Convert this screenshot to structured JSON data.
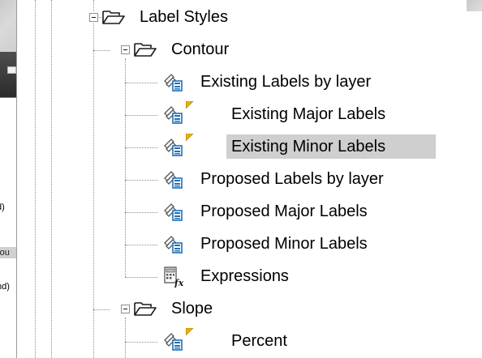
{
  "left_panel": {
    "texts": [
      "d)",
      "rou",
      ")",
      "nd)"
    ]
  },
  "tree": {
    "label_styles": "Label Styles",
    "contour": "Contour",
    "contour_items": [
      "Existing Labels by layer",
      "Existing Major Labels",
      "Existing Minor Labels",
      "Proposed Labels by layer",
      "Proposed Major Labels",
      "Proposed Minor Labels"
    ],
    "expressions": "Expressions",
    "slope": "Slope",
    "slope_items": [
      "Percent"
    ],
    "selected": "Existing Minor Labels"
  },
  "colors": {
    "selection": "#cfcfcf",
    "default_marker": "#e8b000",
    "icon_blue": "#1f6fb8"
  },
  "icons": {
    "folder": "folder-open-icon",
    "label_style": "label-style-icon",
    "expressions": "expressions-icon",
    "default_marker": "default-style-marker-icon",
    "toggle": "collapse-toggle-icon"
  }
}
